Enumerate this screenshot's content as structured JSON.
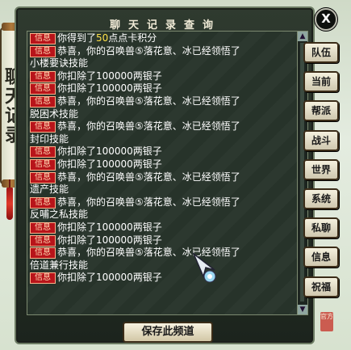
{
  "window": {
    "title": "聊天记录查询",
    "close_label": "X",
    "side_tab_label": "聊天记录",
    "save_button_label": "保存此频道",
    "seal_text": "官方"
  },
  "channels": [
    "队伍",
    "当前",
    "帮派",
    "战斗",
    "世界",
    "系统",
    "私聊",
    "信息",
    "祝福"
  ],
  "tag_label": "信息",
  "log_lines": [
    {
      "tag": true,
      "pre": "你得到了",
      "highlight": "50",
      "post": "点点卡积分"
    },
    {
      "tag": true,
      "pre": "恭喜，你的召唤兽⑤落花意、冰已经领悟了",
      "highlight": "",
      "post": ""
    },
    {
      "tag": false,
      "pre": "小楼要诀技能",
      "highlight": "",
      "post": ""
    },
    {
      "tag": true,
      "pre": "你扣除了100000两银子",
      "highlight": "",
      "post": ""
    },
    {
      "tag": true,
      "pre": "你扣除了100000两银子",
      "highlight": "",
      "post": ""
    },
    {
      "tag": true,
      "pre": "恭喜，你的召唤兽⑤落花意、冰已经领悟了",
      "highlight": "",
      "post": ""
    },
    {
      "tag": false,
      "pre": "脱困术技能",
      "highlight": "",
      "post": ""
    },
    {
      "tag": true,
      "pre": "恭喜，你的召唤兽⑤落花意、冰已经领悟了",
      "highlight": "",
      "post": ""
    },
    {
      "tag": false,
      "pre": "封印技能",
      "highlight": "",
      "post": ""
    },
    {
      "tag": true,
      "pre": "你扣除了100000两银子",
      "highlight": "",
      "post": ""
    },
    {
      "tag": true,
      "pre": "你扣除了100000两银子",
      "highlight": "",
      "post": ""
    },
    {
      "tag": true,
      "pre": "恭喜，你的召唤兽⑤落花意、冰已经领悟了",
      "highlight": "",
      "post": ""
    },
    {
      "tag": false,
      "pre": "遗产技能",
      "highlight": "",
      "post": ""
    },
    {
      "tag": true,
      "pre": "恭喜，你的召唤兽⑤落花意、冰已经领悟了",
      "highlight": "",
      "post": ""
    },
    {
      "tag": false,
      "pre": "反哺之私技能",
      "highlight": "",
      "post": ""
    },
    {
      "tag": true,
      "pre": "你扣除了100000两银子",
      "highlight": "",
      "post": ""
    },
    {
      "tag": true,
      "pre": "你扣除了100000两银子",
      "highlight": "",
      "post": ""
    },
    {
      "tag": true,
      "pre": "恭喜，你的召唤兽⑤落花意、冰已经领悟了",
      "highlight": "",
      "post": ""
    },
    {
      "tag": false,
      "pre": "倍道兼行技能",
      "highlight": "",
      "post": ""
    },
    {
      "tag": true,
      "pre": "你扣除了100000两银子",
      "highlight": "",
      "post": ""
    }
  ]
}
